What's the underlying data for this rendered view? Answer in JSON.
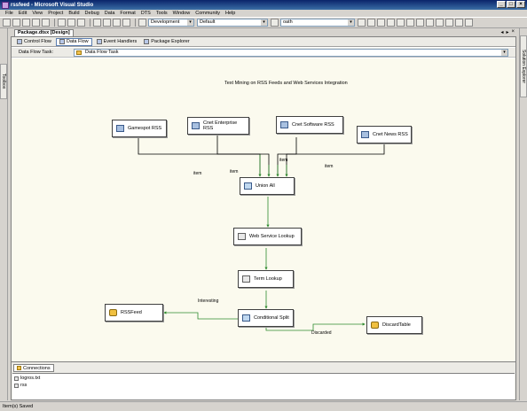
{
  "window": {
    "title": "rssfeed - Microsoft Visual Studio"
  },
  "menu": [
    "File",
    "Edit",
    "View",
    "Project",
    "Build",
    "Debug",
    "Data",
    "Format",
    "DTS",
    "Tools",
    "Window",
    "Community",
    "Help"
  ],
  "toolbar": {
    "config_value": "Development",
    "platform_value": "Default",
    "find_value": "oath"
  },
  "left_gutter": {
    "label": "Toolbox"
  },
  "right_gutter": {
    "label": "Solution Explorer"
  },
  "document_tab": {
    "label": "Package.dtsx [Design]"
  },
  "designer_tabs": [
    "Control Flow",
    "Data Flow",
    "Event Handlers",
    "Package Explorer"
  ],
  "task": {
    "label": "Data Flow Task:",
    "value": "Data Flow Task"
  },
  "canvas": {
    "title": "Text Mining on RSS Feeds and Web Services Integration",
    "nodes": {
      "gamespot": "Gamespot RSS",
      "cnet_enterprise": "Cnet Enterprise RSS",
      "cnet_software": "Cnet Software RSS",
      "cnet_news": "Cnet News RSS",
      "union_all": "Union All",
      "web_service_lookup": "Web Service Lookup",
      "term_lookup": "Term Lookup",
      "conditional_split": "Conditional Split",
      "rssfeed": "RSSFeed",
      "discard_table": "DiscardTable"
    },
    "path_labels": {
      "item1": "item",
      "item2": "item",
      "item3": "item",
      "item4": "item",
      "interesting": "Interesting",
      "discarded": "Discarded"
    }
  },
  "connections": {
    "tab": "Connections",
    "items": [
      "logros.txt",
      "rss"
    ]
  },
  "status": {
    "text": "Item(s) Saved"
  },
  "colors": {
    "flow_green": "#2e8b2e",
    "flow_black": "#000000",
    "titlebar": "#0a246a",
    "canvas": "#fbfaee"
  }
}
